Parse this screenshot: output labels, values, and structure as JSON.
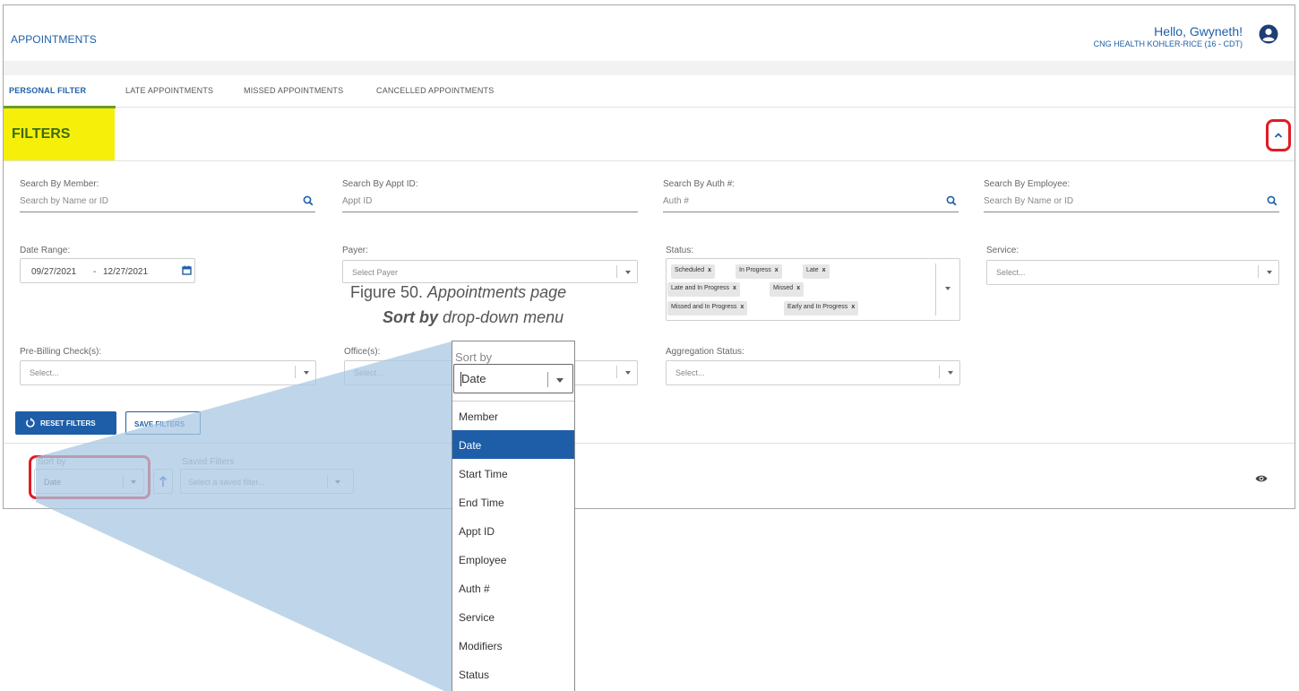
{
  "header": {
    "title": "APPOINTMENTS",
    "greeting": "Hello, Gwyneth!",
    "organization": "CNG HEALTH KOHLER-RICE (16 - CDT)"
  },
  "tabs": [
    {
      "label": "PERSONAL FILTER",
      "active": true
    },
    {
      "label": "LATE APPOINTMENTS"
    },
    {
      "label": "MISSED APPOINTMENTS"
    },
    {
      "label": "CANCELLED APPOINTMENTS"
    }
  ],
  "filters": {
    "title": "FILTERS",
    "search_member": {
      "label": "Search By Member:",
      "placeholder": "Search by Name or ID"
    },
    "search_appt": {
      "label": "Search By Appt ID:",
      "placeholder": "Appt ID"
    },
    "search_auth": {
      "label": "Search By Auth #:",
      "placeholder": "Auth #"
    },
    "search_employee": {
      "label": "Search By Employee:",
      "placeholder": "Search By Name or ID"
    },
    "date_range": {
      "label": "Date Range:",
      "from": "09/27/2021",
      "separator": "-",
      "to": "12/27/2021"
    },
    "payer": {
      "label": "Payer:",
      "placeholder": "Select Payer"
    },
    "status": {
      "label": "Status:",
      "chips": [
        "Scheduled",
        "In Progress",
        "Late",
        "Late and In Progress",
        "Missed",
        "Missed and In Progress",
        "Early and In Progress"
      ],
      "remove_glyph": "x"
    },
    "service": {
      "label": "Service:",
      "placeholder": "Select..."
    },
    "pre_billing": {
      "label": "Pre-Billing Check(s):",
      "placeholder": "Select..."
    },
    "offices": {
      "label": "Office(s):",
      "placeholder": "Select..."
    },
    "aggregation": {
      "label": "Aggregation Status:",
      "placeholder": "Select..."
    },
    "reset_label": "RESET FILTERS",
    "save_label": "SAVE FILTERS"
  },
  "bottom": {
    "sort_label": "Sort by",
    "sort_value": "Date",
    "saved_label": "Saved Filters",
    "saved_placeholder": "Select a saved filter..."
  },
  "caption": {
    "line1_prefix": "Figure 50. ",
    "line1_italic": "Appointments page",
    "line2_bold": "Sort by",
    "line2_rest": " drop-down menu"
  },
  "zoom": {
    "label": "Sort by",
    "value": "Date",
    "options": [
      "Member",
      "Date",
      "Start Time",
      "End Time",
      "Appt ID",
      "Employee",
      "Auth #",
      "Service",
      "Modifiers",
      "Status"
    ],
    "selected": "Date"
  },
  "colors": {
    "brand_blue": "#1e5ea8",
    "highlight_yellow": "#f6ef0a",
    "callout_red": "#e21b23",
    "tab_underline_green": "#6b9c2a",
    "cone_blue": "#a9c7e3"
  }
}
